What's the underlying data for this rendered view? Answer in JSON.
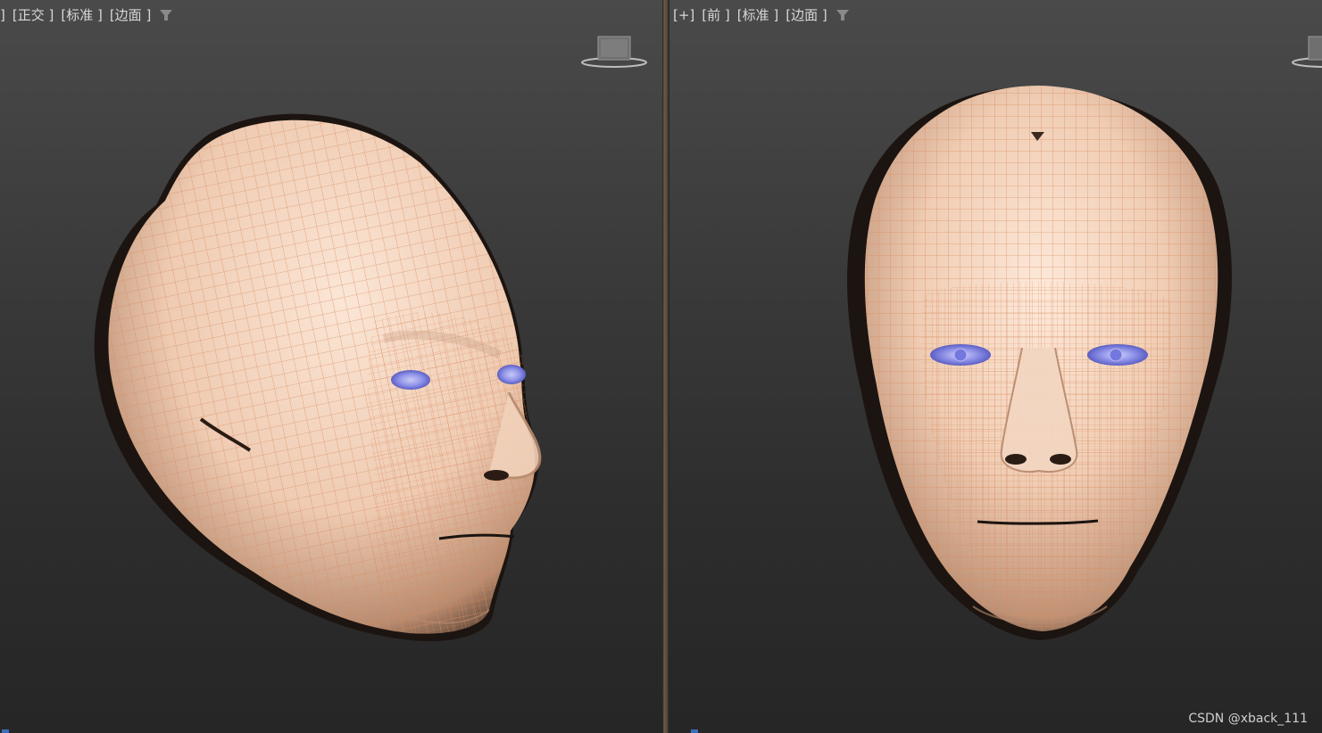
{
  "left_viewport": {
    "labels": [
      "]",
      "[正交 ]",
      "[标准 ]",
      "[边面 ]"
    ],
    "filter_icon": "filter-icon",
    "viewcube_icon": "viewcube-icon"
  },
  "right_viewport": {
    "labels": [
      "[+]",
      "[前 ]",
      "[标准 ]",
      "[边面 ]"
    ],
    "filter_icon": "filter-icon",
    "viewcube_icon": "viewcube-icon"
  },
  "watermark": "CSDN @xback_111",
  "colors": {
    "skin": "#f1cfb6",
    "wire": "#d98a5c",
    "eye": "#8f92e8",
    "background_top": "#4a4a4a",
    "background_bottom": "#262626"
  }
}
